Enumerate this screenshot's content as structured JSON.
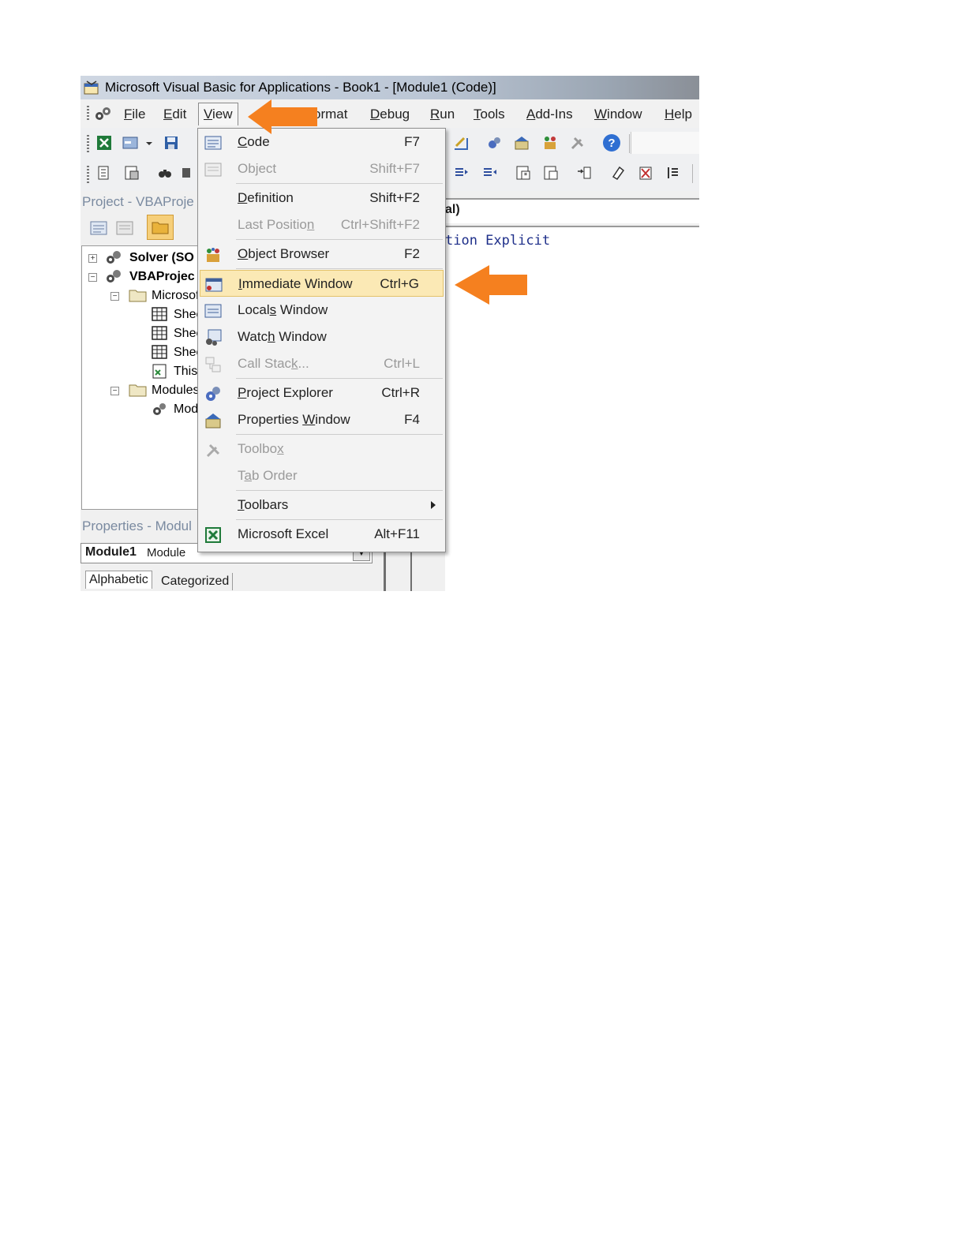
{
  "window": {
    "title": "Microsoft Visual Basic for Applications - Book1 - [Module1 (Code)]"
  },
  "menubar": {
    "items": [
      {
        "label": "File"
      },
      {
        "label": "Edit"
      },
      {
        "label": "View"
      },
      {
        "label": "ormat"
      },
      {
        "label": "Debug"
      },
      {
        "label": "Run"
      },
      {
        "label": "Tools"
      },
      {
        "label": "Add-Ins"
      },
      {
        "label": "Window"
      },
      {
        "label": "Help"
      }
    ]
  },
  "view_menu": {
    "items": [
      {
        "label": "Code",
        "shortcut": "F7",
        "icon": "code-window-icon",
        "enabled": true
      },
      {
        "label": "Object",
        "shortcut": "Shift+F7",
        "icon": "object-icon",
        "enabled": false
      },
      {
        "label": "Definition",
        "shortcut": "Shift+F2",
        "enabled": true
      },
      {
        "label": "Last Position",
        "shortcut": "Ctrl+Shift+F2",
        "enabled": false
      },
      {
        "label": "Object Browser",
        "shortcut": "F2",
        "icon": "object-browser-icon",
        "enabled": true
      },
      {
        "label": "Immediate Window",
        "shortcut": "Ctrl+G",
        "icon": "immediate-window-icon",
        "enabled": true,
        "highlighted": true
      },
      {
        "label": "Locals Window",
        "shortcut": "",
        "icon": "locals-window-icon",
        "enabled": true
      },
      {
        "label": "Watch Window",
        "shortcut": "",
        "icon": "watch-window-icon",
        "enabled": true
      },
      {
        "label": "Call Stack...",
        "shortcut": "Ctrl+L",
        "icon": "call-stack-icon",
        "enabled": false
      },
      {
        "label": "Project Explorer",
        "shortcut": "Ctrl+R",
        "icon": "project-explorer-icon",
        "enabled": true
      },
      {
        "label": "Properties Window",
        "shortcut": "F4",
        "icon": "properties-window-icon",
        "enabled": true
      },
      {
        "label": "Toolbox",
        "shortcut": "",
        "icon": "toolbox-icon",
        "enabled": false
      },
      {
        "label": "Tab Order",
        "shortcut": "",
        "enabled": false
      },
      {
        "label": "Toolbars",
        "shortcut": "",
        "enabled": true,
        "submenu": true
      },
      {
        "label": "Microsoft Excel",
        "shortcut": "Alt+F11",
        "icon": "excel-icon",
        "enabled": true
      }
    ]
  },
  "project_pane": {
    "title": "Project - VBAProje",
    "tree": [
      {
        "label": "Solver (SO"
      },
      {
        "label": "VBAProjec"
      },
      {
        "label": "Microsof"
      },
      {
        "label": "Shee"
      },
      {
        "label": "Shee"
      },
      {
        "label": "Shee"
      },
      {
        "label": "This"
      },
      {
        "label": "Modules"
      },
      {
        "label": "Mod"
      }
    ]
  },
  "properties_pane": {
    "title": "Properties - Modul",
    "object_name": "Module1",
    "object_type": "Module",
    "tabs": [
      "Alphabetic",
      "Categorized"
    ]
  },
  "code_pane": {
    "object_combo": "al)",
    "lines": [
      "tion Explicit"
    ]
  },
  "colors": {
    "menu_highlight": "#fbe9b5",
    "annotation_arrow": "#f5801f",
    "code_keyword": "#1e2f8a"
  }
}
